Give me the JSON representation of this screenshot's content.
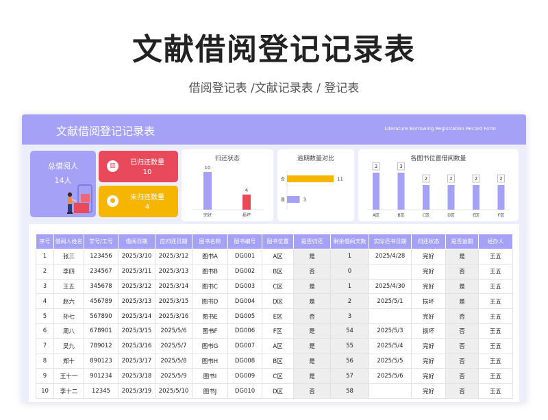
{
  "page": {
    "title": "文献借阅登记记录表",
    "subtitle": "借阅登记表 /文献记录表 / 登记表"
  },
  "header": {
    "title": "文献借阅登记记录表",
    "subtitle_en": "Literature Borrowing Registration Record Form"
  },
  "stats": {
    "total_label": "总借阅人",
    "total_value": "14人",
    "returned_label": "已归还数量",
    "returned_value": "10",
    "unreturned_label": "未归还数量",
    "unreturned_value": "4"
  },
  "colors": {
    "accent": "#a4a1f6",
    "red": "#e84a5b",
    "yellow": "#f5b500"
  },
  "chart_data": [
    {
      "type": "bar",
      "title": "归还状态",
      "categories": [
        "完好",
        "损坏"
      ],
      "values": [
        10,
        4
      ],
      "colors": [
        "#a4a1f6",
        "#e84a5b"
      ],
      "ylim": [
        0,
        10
      ],
      "grid": false
    },
    {
      "type": "bar",
      "orientation": "horizontal",
      "title": "逾期数量对比",
      "categories": [
        "否",
        "是"
      ],
      "values": [
        11,
        3
      ],
      "colors": [
        "#f5b500",
        "#a4a1f6"
      ],
      "xlim": [
        0,
        11
      ],
      "grid": false
    },
    {
      "type": "bar",
      "title": "各图书位置借阅数量",
      "categories": [
        "A区",
        "B区",
        "C区",
        "D区",
        "E区",
        "F区"
      ],
      "values": [
        3,
        3,
        2,
        2,
        2,
        2
      ],
      "colors": [
        "#a4a1f6"
      ],
      "ylim": [
        0,
        3
      ],
      "grid": false
    }
  ],
  "table": {
    "columns": [
      "序号",
      "借阅人姓名",
      "学号/工号",
      "借阅日期",
      "应归还日期",
      "图书名称",
      "图书编号",
      "图书位置",
      "是否归还",
      "剩余借阅天数",
      "实际还书日期",
      "归还状态",
      "是否逾期",
      "经办人"
    ],
    "rows": [
      [
        "1",
        "张三",
        "123456",
        "2025/3/10",
        "2025/3/12",
        "图书A",
        "DG001",
        "A区",
        "是",
        "1",
        "2025/4/28",
        "完好",
        "是",
        "王五"
      ],
      [
        "2",
        "李四",
        "234567",
        "2025/3/11",
        "2025/3/13",
        "图书B",
        "DG002",
        "B区",
        "否",
        "0",
        "",
        "完好",
        "否",
        "王五"
      ],
      [
        "3",
        "王五",
        "345678",
        "2025/3/12",
        "2025/3/14",
        "图书C",
        "DG003",
        "C区",
        "是",
        "1",
        "2025/4/30",
        "完好",
        "是",
        "王五"
      ],
      [
        "4",
        "赵六",
        "456789",
        "2025/3/13",
        "2025/3/15",
        "图书D",
        "DG004",
        "D区",
        "是",
        "2",
        "2025/5/1",
        "损坏",
        "是",
        "王五"
      ],
      [
        "5",
        "孙七",
        "567890",
        "2025/3/14",
        "2025/3/16",
        "图书E",
        "DG005",
        "E区",
        "否",
        "3",
        "",
        "完好",
        "否",
        "王五"
      ],
      [
        "6",
        "周八",
        "678901",
        "2025/3/15",
        "2025/5/6",
        "图书F",
        "DG006",
        "F区",
        "是",
        "54",
        "2025/5/3",
        "损坏",
        "否",
        "王五"
      ],
      [
        "7",
        "吴九",
        "789012",
        "2025/3/16",
        "2025/5/7",
        "图书G",
        "DG007",
        "A区",
        "是",
        "55",
        "2025/5/4",
        "完好",
        "否",
        "王五"
      ],
      [
        "8",
        "郑十",
        "890123",
        "2025/3/17",
        "2025/5/8",
        "图书H",
        "DG008",
        "B区",
        "是",
        "56",
        "2025/5/5",
        "完好",
        "否",
        "王五"
      ],
      [
        "9",
        "王十一",
        "901234",
        "2025/3/18",
        "2025/5/9",
        "图书I",
        "DG009",
        "C区",
        "是",
        "57",
        "2025/5/6",
        "完好",
        "否",
        "王五"
      ],
      [
        "10",
        "李十二",
        "12345",
        "2025/3/19",
        "2025/5/10",
        "图书J",
        "DG010",
        "D区",
        "否",
        "58",
        "",
        "完好",
        "否",
        "王五"
      ]
    ]
  }
}
